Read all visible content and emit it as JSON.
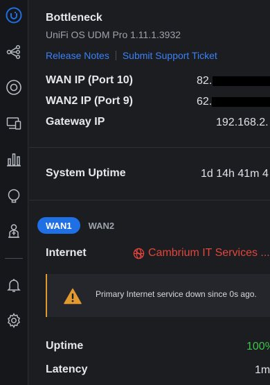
{
  "device": {
    "name": "Bottleneck",
    "version": "UniFi OS UDM Pro 1.11.1.3932"
  },
  "links": {
    "release_notes": "Release Notes",
    "support_ticket": "Submit Support Ticket"
  },
  "network": {
    "wan_ip_label": "WAN IP (Port 10)",
    "wan_ip_value": "82.",
    "wan2_ip_label": "WAN2 IP (Port 9)",
    "wan2_ip_value": "62.",
    "gateway_ip_label": "Gateway IP",
    "gateway_ip_value": "192.168.2."
  },
  "system": {
    "uptime_label": "System Uptime",
    "uptime_value": "1d 14h 41m 4"
  },
  "wan_tabs": [
    {
      "label": "WAN1",
      "active": true
    },
    {
      "label": "WAN2",
      "active": false
    }
  ],
  "internet": {
    "label": "Internet",
    "isp": "Cambrium IT Services ..."
  },
  "alert": {
    "message": "Primary Internet service down since 0s ago."
  },
  "stats": {
    "uptime_label": "Uptime",
    "uptime_value": "100%",
    "latency_label": "Latency",
    "latency_value": "1m"
  },
  "colors": {
    "accent": "#1f6fe5",
    "link": "#3b82f6",
    "error": "#e5453b",
    "warning": "#e09a2f",
    "success": "#3ec54a"
  },
  "sidebar": {
    "icons": [
      "unifi-logo-icon",
      "topology-icon",
      "network-icon",
      "devices-icon",
      "statistics-icon",
      "insights-icon",
      "admin-icon",
      "notifications-icon",
      "settings-icon"
    ]
  }
}
